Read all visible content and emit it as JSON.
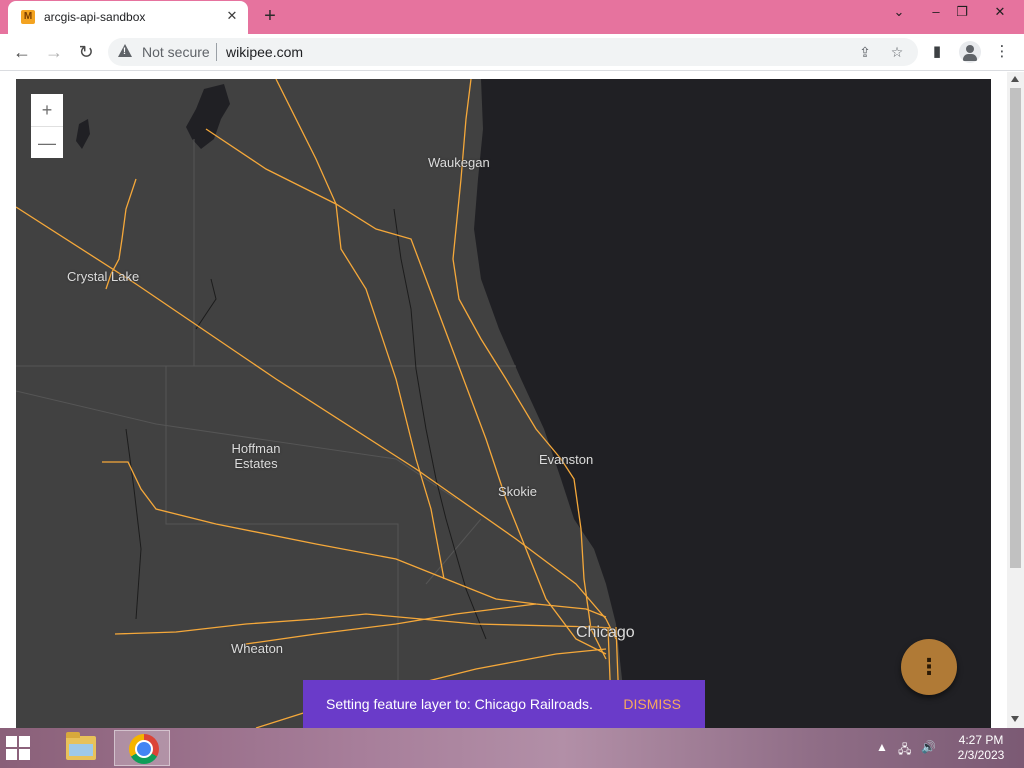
{
  "browser": {
    "tab": {
      "favicon": "M",
      "title": "arcgis-api-sandbox"
    },
    "new_tab_icon": "plus-icon",
    "window_controls": {
      "minimize": "–",
      "restore": "❐",
      "close": "✕",
      "tab_list": "⌄"
    },
    "address": {
      "security_label": "Not secure",
      "url": "wikipee.com"
    }
  },
  "map": {
    "zoom": {
      "in": "+",
      "out": "—"
    },
    "labels": [
      {
        "text": "Waukegan"
      },
      {
        "text": "Crystal Lake"
      },
      {
        "text": "Hoffman Estates"
      },
      {
        "text": "Evanston"
      },
      {
        "text": "Skokie"
      },
      {
        "text": "Chicago"
      },
      {
        "text": "Wheaton"
      }
    ],
    "layer_color": "#f5a83a",
    "lake_color": "#202024",
    "land_color": "#414141",
    "menu_button_icon": "⋮"
  },
  "snackbar": {
    "message": "Setting feature layer to: Chicago Railroads.",
    "action": "DISMISS"
  },
  "taskbar": {
    "clock": {
      "time": "4:27 PM",
      "date": "2/3/2023"
    }
  }
}
